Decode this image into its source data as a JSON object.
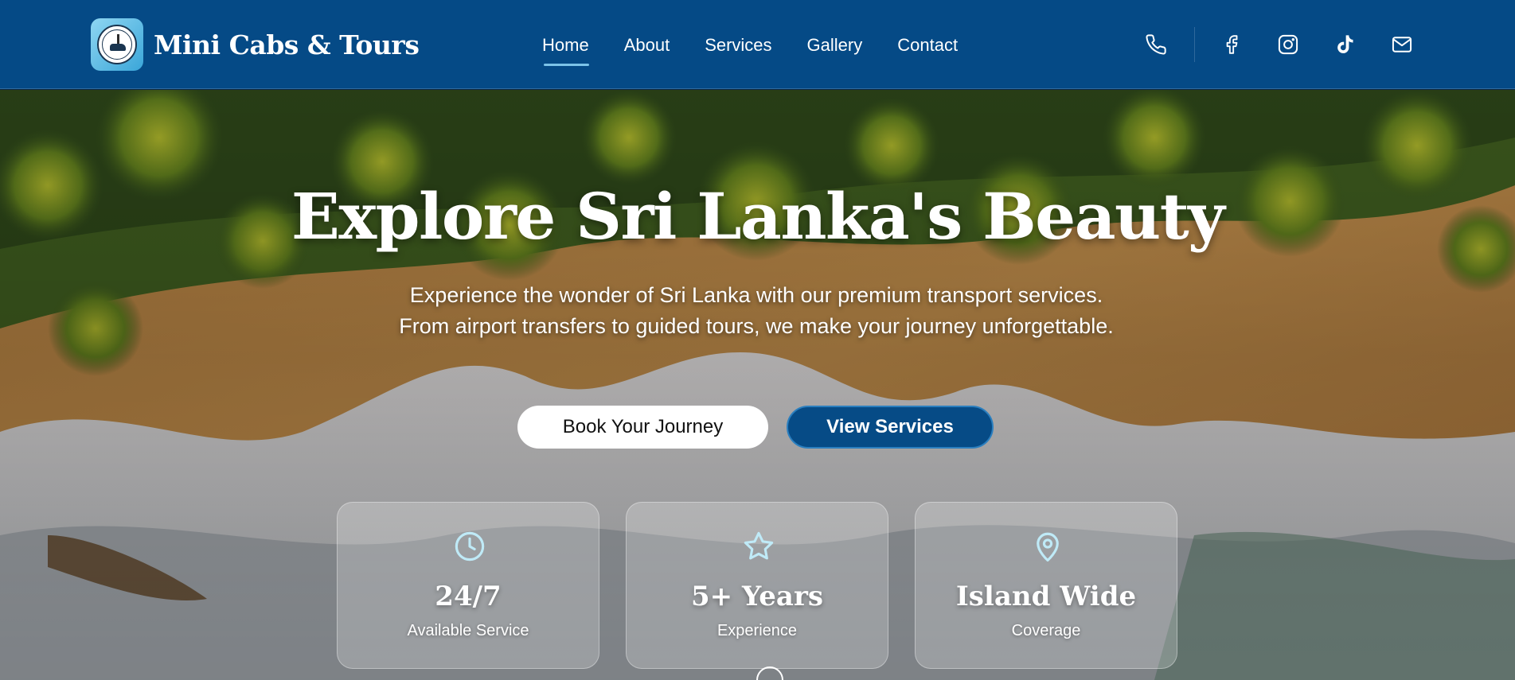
{
  "brand": {
    "name": "Mini Cabs & Tours",
    "logo_icon": "mini-cabs-logo"
  },
  "nav": {
    "items": [
      {
        "label": "Home",
        "active": true
      },
      {
        "label": "About",
        "active": false
      },
      {
        "label": "Services",
        "active": false
      },
      {
        "label": "Gallery",
        "active": false
      },
      {
        "label": "Contact",
        "active": false
      }
    ]
  },
  "socials": {
    "icons": [
      "phone-icon",
      "facebook-icon",
      "instagram-icon",
      "tiktok-icon",
      "mail-icon"
    ]
  },
  "hero": {
    "title": "Explore Sri Lanka's Beauty",
    "subtitle": "Experience the wonder of Sri Lanka with our premium transport services. From airport transfers to guided tours, we make your journey unforgettable.",
    "primary_button": "Book Your Journey",
    "secondary_button": "View Services"
  },
  "stats": [
    {
      "icon": "clock-icon",
      "value": "24/7",
      "label": "Available Service"
    },
    {
      "icon": "star-icon",
      "value": "5+ Years",
      "label": "Experience"
    },
    {
      "icon": "map-pin-icon",
      "value": "Island Wide",
      "label": "Coverage"
    }
  ],
  "colors": {
    "header_bg": "#054a86",
    "accent": "#7cc3e8",
    "button_primary_bg": "#ffffff",
    "button_secondary_bg": "#064b86"
  }
}
